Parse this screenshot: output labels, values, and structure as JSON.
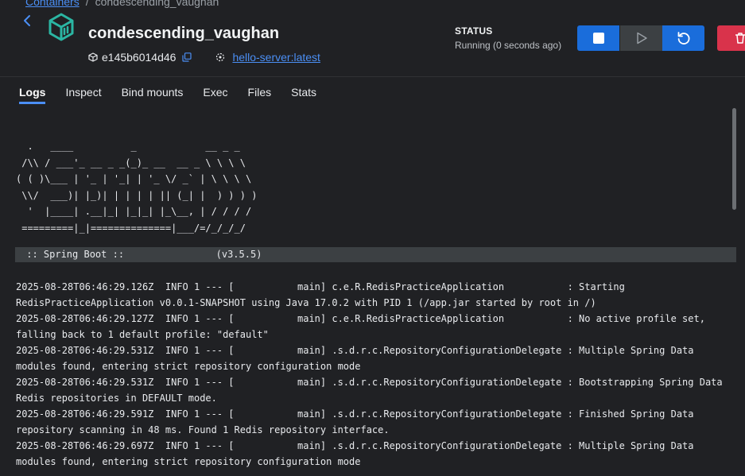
{
  "breadcrumb": {
    "parent": "Containers",
    "separator": "/",
    "current": "condescending_vaughan"
  },
  "container": {
    "name": "condescending_vaughan",
    "id": "e145b6014d46",
    "image": "hello-server:latest"
  },
  "status": {
    "label": "STATUS",
    "value": "Running (0 seconds ago)"
  },
  "actions": [
    "stop",
    "start",
    "restart",
    "delete"
  ],
  "tabs": [
    {
      "label": "Logs",
      "active": true
    },
    {
      "label": "Inspect"
    },
    {
      "label": "Bind mounts"
    },
    {
      "label": "Exec"
    },
    {
      "label": "Files"
    },
    {
      "label": "Stats"
    }
  ],
  "logs": {
    "banner": "  .   ____          _            __ _ _\n /\\\\ / ___'_ __ _ _(_)_ __  __ _ \\ \\ \\ \\\n( ( )\\___ | '_ | '_| | '_ \\/ _` | \\ \\ \\ \\\n \\\\/  ___)| |_)| | | | | || (_| |  ) ) ) )\n  '  |____| .__|_| |_|_| |_\\__, | / / / /\n =========|_|==============|___/=/_/_/_/",
    "boot": " :: Spring Boot ::                (v3.5.5)",
    "lines": [
      "2025-08-28T06:46:29.126Z  INFO 1 --- [           main] c.e.R.RedisPracticeApplication           : Starting",
      "RedisPracticeApplication v0.0.1-SNAPSHOT using Java 17.0.2 with PID 1 (/app.jar started by root in /)",
      "2025-08-28T06:46:29.127Z  INFO 1 --- [           main] c.e.R.RedisPracticeApplication           : No active profile set,",
      "falling back to 1 default profile: \"default\"",
      "2025-08-28T06:46:29.531Z  INFO 1 --- [           main] .s.d.r.c.RepositoryConfigurationDelegate : Multiple Spring Data",
      "modules found, entering strict repository configuration mode",
      "2025-08-28T06:46:29.531Z  INFO 1 --- [           main] .s.d.r.c.RepositoryConfigurationDelegate : Bootstrapping Spring Data",
      "Redis repositories in DEFAULT mode.",
      "2025-08-28T06:46:29.591Z  INFO 1 --- [           main] .s.d.r.c.RepositoryConfigurationDelegate : Finished Spring Data",
      "repository scanning in 48 ms. Found 1 Redis repository interface.",
      "2025-08-28T06:46:29.697Z  INFO 1 --- [           main] .s.d.r.c.RepositoryConfigurationDelegate : Multiple Spring Data",
      "modules found, entering strict repository configuration mode"
    ]
  },
  "colors": {
    "accent": "#1a6ddb",
    "link": "#4b8ff5",
    "danger": "#d9334b",
    "container_icon": "#2bb6a3",
    "background": "#202124"
  }
}
